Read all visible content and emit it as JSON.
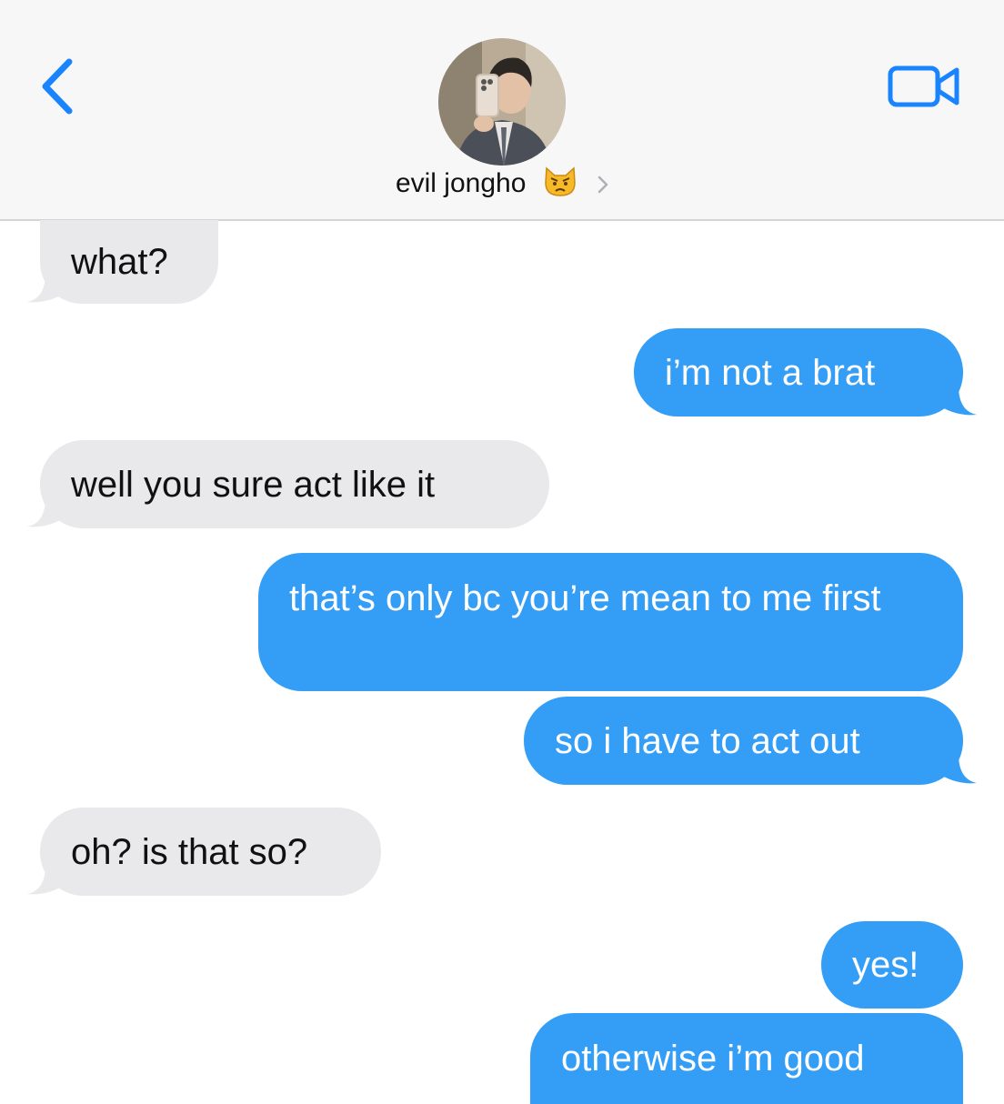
{
  "header": {
    "contact_name": "evil jongho",
    "contact_emoji": "pouting-cat-emoji",
    "icons": {
      "back": "chevron-left-icon",
      "video": "video-camera-icon",
      "disclosure": "chevron-right-icon"
    }
  },
  "colors": {
    "accent": "#1a84ff",
    "sent_bubble": "#349ef7",
    "received_bubble": "#e9e9eb",
    "header_bg": "#f7f7f7"
  },
  "messages": [
    {
      "from": "them",
      "text": "what?"
    },
    {
      "from": "me",
      "text": "i’m not a brat"
    },
    {
      "from": "them",
      "text": "well you sure act like it"
    },
    {
      "from": "me",
      "text": "that’s only bc you’re mean to me first"
    },
    {
      "from": "me",
      "text": "so i have to act out"
    },
    {
      "from": "them",
      "text": "oh? is that so?"
    },
    {
      "from": "me",
      "text": "yes!"
    },
    {
      "from": "me",
      "text": "otherwise i’m good"
    }
  ]
}
